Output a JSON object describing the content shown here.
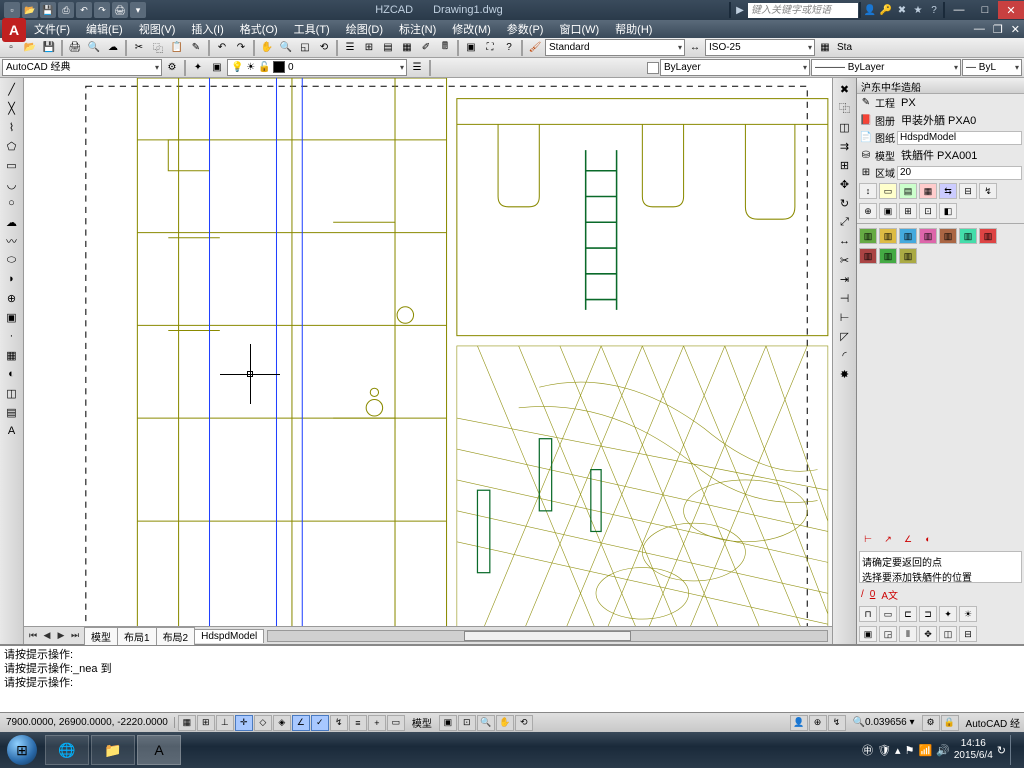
{
  "title": {
    "app": "HZCAD",
    "file": "Drawing1.dwg"
  },
  "search_placeholder": "键入关键字或短语",
  "menus": [
    "文件(F)",
    "编辑(E)",
    "视图(V)",
    "插入(I)",
    "格式(O)",
    "工具(T)",
    "绘图(D)",
    "标注(N)",
    "修改(M)",
    "参数(P)",
    "窗口(W)",
    "帮助(H)"
  ],
  "workspace": "AutoCAD 经典",
  "layer_current": "0",
  "style_text": "Standard",
  "style_dim": "ISO-25",
  "style_tab": "Sta",
  "props": {
    "color": "ByLayer",
    "linetype": "ByLayer",
    "lineweight": "ByL"
  },
  "tabs": [
    "模型",
    "布局1",
    "布局2",
    "HdspdModel"
  ],
  "tabs_active": 3,
  "cmd_lines": [
    "请按提示操作:",
    "请按提示操作:_nea 到",
    "",
    "请按提示操作:"
  ],
  "status": {
    "coords": "7900.0000, 26900.0000, -2220.0000",
    "model_label": "模型",
    "scale": "0.039656",
    "ws": "AutoCAD 经"
  },
  "panel": {
    "title": "沪东中华造船",
    "project_label": "工程",
    "project_value": "PX",
    "book_label": "图册",
    "book_value": "甲装外舾 PXA0",
    "drawing_label": "图纸",
    "drawing_value": "HdspdModel",
    "model_label": "模型",
    "model_value": "铁舾件 PXA001",
    "zone_label": "区域",
    "zone_value": "20",
    "msg1": "请确定要返回的点",
    "msg2": "选择要添加铁舾件的位置",
    "dim_linear": "/",
    "dim_zero": "0",
    "dim_text": "A文"
  },
  "clock": {
    "time": "14:16",
    "date": "2015/6/4"
  }
}
